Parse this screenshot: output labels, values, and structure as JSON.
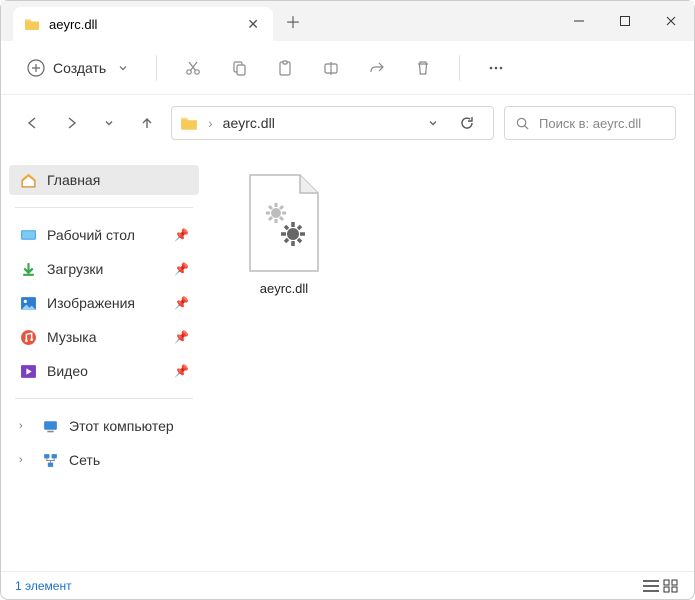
{
  "titlebar": {
    "tab_label": "aeyrc.dll"
  },
  "toolbar": {
    "create_label": "Создать"
  },
  "address": {
    "path": "aeyrc.dll"
  },
  "search": {
    "placeholder": "Поиск в: aeyrc.dll"
  },
  "sidebar": {
    "home": "Главная",
    "desktop": "Рабочий стол",
    "downloads": "Загрузки",
    "pictures": "Изображения",
    "music": "Музыка",
    "videos": "Видео",
    "this_pc": "Этот компьютер",
    "network": "Сеть"
  },
  "files": {
    "item0": "aeyrc.dll"
  },
  "status": {
    "count_text": "1 элемент"
  }
}
